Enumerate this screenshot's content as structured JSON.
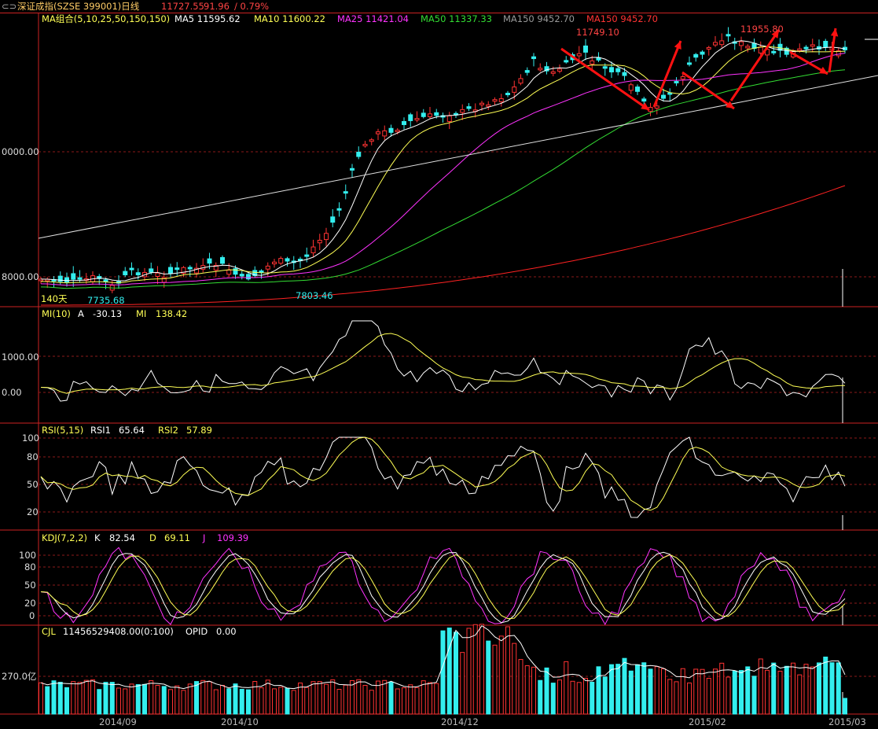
{
  "title_bar": {
    "name": "深证成指(SZSE 399001)日线",
    "price": "11727.55",
    "change": "91.96",
    "change_pct": "/ 0.79%"
  },
  "price_panel": {
    "ma_group": "MA组合(5,10,25,50,150,150)",
    "ma": [
      {
        "label": "MA5 11595.62",
        "color": "#ffffff"
      },
      {
        "label": "MA10 11600.22",
        "color": "#ffff55"
      },
      {
        "label": "MA25 11421.04",
        "color": "#ff33ff"
      },
      {
        "label": "MA50 11337.33",
        "color": "#33dd33"
      },
      {
        "label": "MA150 9452.70",
        "color": "#999999"
      },
      {
        "label": "MA150 9452.70",
        "color": "#ff3333"
      }
    ],
    "high_label_1": "11749.10",
    "high_label_2": "11955.80",
    "low_label_1": "7735.68",
    "low_label_2": "7803.46",
    "days_label": "140天",
    "yaxis": [
      "0000.00",
      "8000.00"
    ]
  },
  "mi_panel": {
    "name": "MI(10)",
    "a_label": "A",
    "a_value": "-30.13",
    "mi_label": "MI",
    "mi_value": "138.42",
    "yaxis": [
      "1000.00",
      "0.00"
    ]
  },
  "rsi_panel": {
    "name": "RSI(5,15)",
    "rsi1_label": "RSI1",
    "rsi1_value": "65.64",
    "rsi2_label": "RSI2",
    "rsi2_value": "57.89",
    "yaxis": [
      "100",
      "80",
      "50",
      "20"
    ]
  },
  "kdj_panel": {
    "name": "KDJ(7,2,2)",
    "k_label": "K",
    "k_value": "82.54",
    "d_label": "D",
    "d_value": "69.11",
    "j_label": "J",
    "j_value": "109.39",
    "yaxis": [
      "100",
      "80",
      "50",
      "20",
      "0"
    ]
  },
  "vol_panel": {
    "name": "CJL",
    "value": "11456529408.00(0:100)",
    "opid_label": "OPID",
    "opid_value": "0.00",
    "yaxis": "270.0亿"
  },
  "x_axis": [
    "2014/09",
    "2014/10",
    "2014/12",
    "2015/02",
    "2015/03"
  ],
  "colors": {
    "up": "#ff3333",
    "down": "#33eeee",
    "grid": "#8b1a1a",
    "axis": "#cc2222",
    "ma5": "#ffffff",
    "ma10": "#ffff55",
    "ma25": "#ff33ff",
    "ma50": "#33dd33",
    "ma150": "#ff2222",
    "arrow": "#ff1111"
  }
}
